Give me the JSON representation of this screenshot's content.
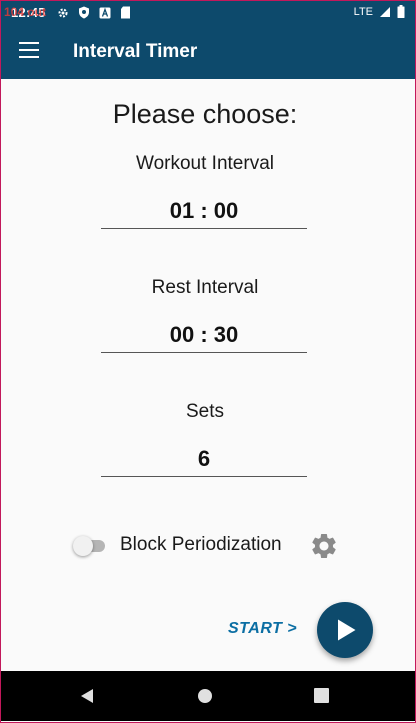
{
  "status_bar": {
    "time": "12:45",
    "debug_overlay": "104 out",
    "network": "LTE",
    "icons": [
      "settings-icon",
      "shield-icon",
      "a-icon",
      "sd-card-icon"
    ]
  },
  "app_bar": {
    "title": "Interval Timer",
    "menu_icon": "hamburger-icon"
  },
  "main": {
    "heading": "Please choose:",
    "workout": {
      "label": "Workout Interval",
      "value": "01 : 00"
    },
    "rest": {
      "label": "Rest Interval",
      "value": "00 : 30"
    },
    "sets": {
      "label": "Sets",
      "value": "6"
    },
    "block_periodization": {
      "label": "Block Periodization",
      "enabled": false
    },
    "start_label": "START >"
  },
  "colors": {
    "primary": "#0d4a6c",
    "accent_link": "#0b6ea3",
    "background": "#fafafa"
  }
}
